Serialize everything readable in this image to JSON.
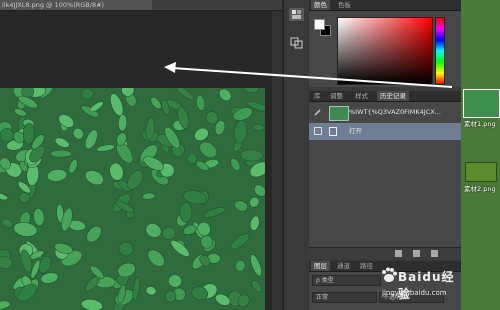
{
  "document": {
    "tab_title": "lik4JJXL8.png @ 100%(RGB/8#)"
  },
  "color_panel": {
    "tabs": [
      "颜色",
      "色板"
    ],
    "active_tab": 0,
    "foreground": "#ffffff",
    "background": "#000000"
  },
  "history_panel": {
    "tabs": [
      "库",
      "调整",
      "样式",
      "历史记录"
    ],
    "active_tab": 3,
    "snapshot_label": "%IWT{%Q3VAZ0FIMK4JCX...",
    "open_label": "打开"
  },
  "layers_panel": {
    "tabs": [
      "图层",
      "通道",
      "路径"
    ],
    "active_tab": 0,
    "kind_filter": "ρ 类型",
    "blend_mode": "正常",
    "opacity_label": "不透明度"
  },
  "desktop": {
    "file1_label": "素材1.png",
    "file2_label": "素材2.png"
  },
  "watermark": {
    "brand": "Baidu经验",
    "url": "jingyan.baidu.com"
  },
  "colors": {
    "panel_bg": "#3a3a3a",
    "history_selected": "#6f7d95",
    "arrow": "#ffffff"
  }
}
